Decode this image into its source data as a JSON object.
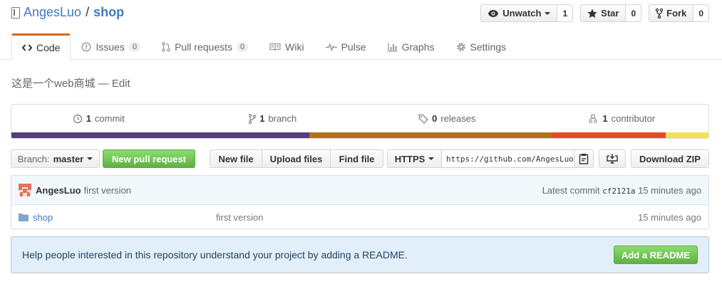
{
  "repo": {
    "owner": "AngesLuo",
    "separator": "/",
    "name": "shop"
  },
  "actions": {
    "watch": {
      "label": "Unwatch",
      "count": "1"
    },
    "star": {
      "label": "Star",
      "count": "0"
    },
    "fork": {
      "label": "Fork",
      "count": "0"
    }
  },
  "tabs": [
    {
      "label": "Code"
    },
    {
      "label": "Issues",
      "count": "0"
    },
    {
      "label": "Pull requests",
      "count": "0"
    },
    {
      "label": "Wiki"
    },
    {
      "label": "Pulse"
    },
    {
      "label": "Graphs"
    },
    {
      "label": "Settings"
    }
  ],
  "description": {
    "text": "这是一个web商城 — ",
    "edit": "Edit"
  },
  "summary": {
    "commits": {
      "count": "1",
      "label": "commit"
    },
    "branches": {
      "count": "1",
      "label": "branch"
    },
    "releases": {
      "count": "0",
      "label": "releases"
    },
    "contributors": {
      "count": "1",
      "label": "contributor"
    },
    "language_colors": [
      {
        "color": "#563d7c",
        "fraction": 0.427
      },
      {
        "color": "#b07219",
        "fraction": 0.348
      },
      {
        "color": "#e34c26",
        "fraction": 0.164
      },
      {
        "color": "#f1e05a",
        "fraction": 0.061
      }
    ]
  },
  "filenav": {
    "branch_prefix": "Branch:",
    "branch": "master",
    "new_pr": "New pull request",
    "new_file": "New file",
    "upload_files": "Upload files",
    "find_file": "Find file",
    "protocol": "HTTPS",
    "clone_url": "https://github.com/AngesLuo/shop.git",
    "download_zip": "Download ZIP"
  },
  "commit": {
    "author": "AngesLuo",
    "message": "first version",
    "latest_prefix": "Latest commit",
    "sha": "cf2121a",
    "age": "15 minutes ago"
  },
  "files": [
    {
      "name": "shop",
      "message": "first version",
      "age": "15 minutes ago"
    }
  ],
  "readme": {
    "text": "Help people interested in this repository understand your project by adding a README.",
    "button": "Add a README"
  }
}
